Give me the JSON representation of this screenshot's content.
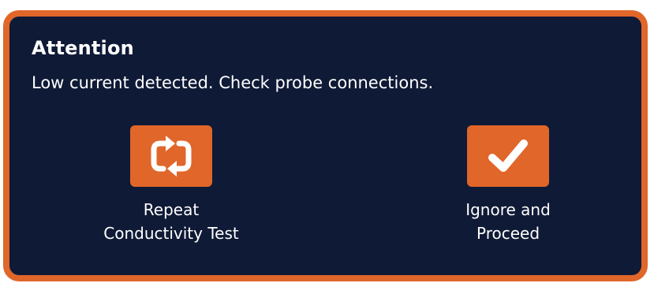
{
  "dialog": {
    "title": "Attention",
    "message": "Low current detected. Check probe connections."
  },
  "actions": [
    {
      "label": "Repeat\nConductivity Test",
      "icon": "refresh-icon"
    },
    {
      "label": "Ignore and\nProceed",
      "icon": "checkmark-icon"
    }
  ],
  "colors": {
    "accent": "#e0662a",
    "background": "#0f1a36",
    "text": "#ffffff"
  }
}
